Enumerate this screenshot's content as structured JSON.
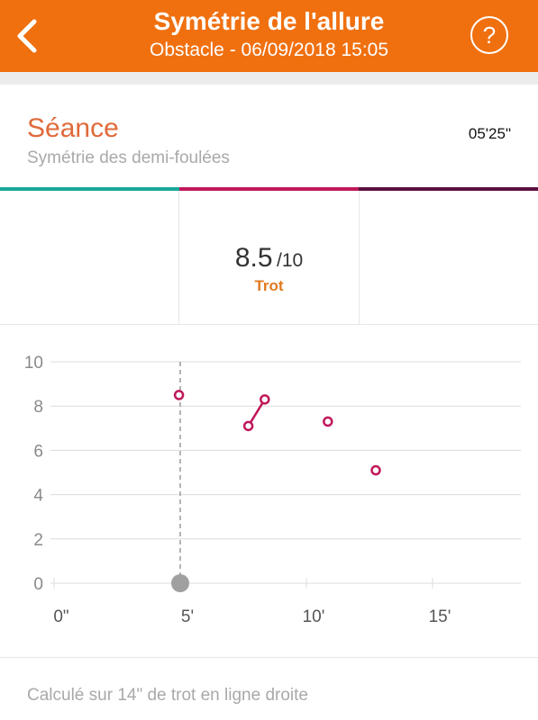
{
  "header": {
    "title": "Symétrie de l'allure",
    "subtitle": "Obstacle - 06/09/2018 15:05",
    "back_icon": "chevron-left-icon",
    "help_icon": "question-circle-icon",
    "help_glyph": "?",
    "color": "#f07010"
  },
  "session": {
    "title": "Séance",
    "subtitle": "Symétrie des demi-foulées",
    "duration": "05'25\""
  },
  "tab_colors": [
    "#1aa89a",
    "#c0185a",
    "#5a1040"
  ],
  "selected": {
    "score": "8.5",
    "max": "/10",
    "gait": "Trot"
  },
  "chart_data": {
    "type": "scatter",
    "x_unit": "minutes",
    "xlim": [
      0,
      18.5
    ],
    "ylim": [
      0,
      10
    ],
    "x_ticks": [
      0,
      5,
      10,
      15
    ],
    "x_tick_labels": [
      "0\"",
      "5'",
      "10'",
      "15'"
    ],
    "y_ticks": [
      0,
      2,
      4,
      6,
      8,
      10
    ],
    "y_tick_labels": [
      "0",
      "2",
      "4",
      "6",
      "8",
      "10"
    ],
    "grid": true,
    "cursor_x": 5.0,
    "series": [
      {
        "color": "#c0185a",
        "segments": [
          [
            [
              4.95,
              8.5
            ]
          ],
          [
            [
              7.7,
              7.1
            ],
            [
              8.35,
              8.3
            ]
          ],
          [
            [
              10.85,
              7.3
            ]
          ],
          [
            [
              12.75,
              5.1
            ]
          ]
        ]
      }
    ]
  },
  "footnote": "Calculé sur 14\" de trot en ligne droite"
}
